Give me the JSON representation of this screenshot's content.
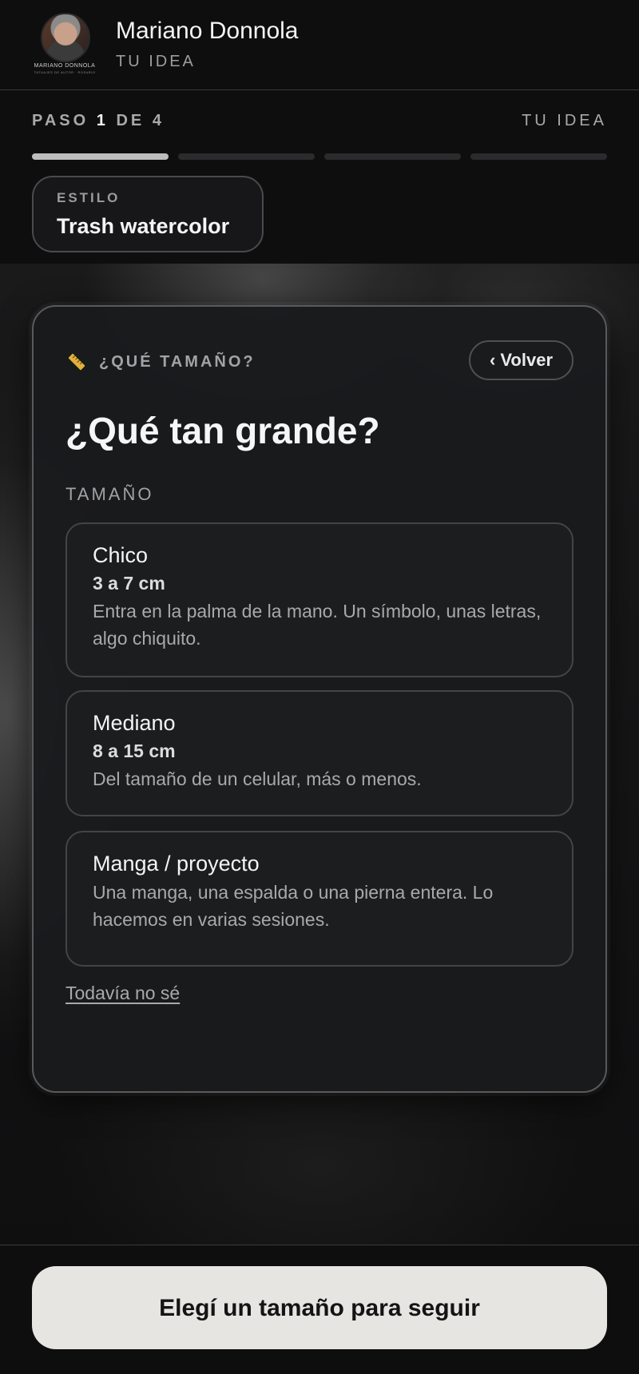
{
  "header": {
    "brand_name": "Mariano Donnola",
    "brand_sub": "TU IDEA",
    "logo_caption": "MARIANO DONNOLA",
    "logo_subcaption": "TATUAJES DE AUTOR · ROSARIO"
  },
  "step": {
    "prefix": "PASO",
    "current": "1",
    "middle": "DE",
    "total": "4",
    "section": "TU IDEA",
    "segments": [
      {
        "active": true
      },
      {
        "active": false
      },
      {
        "active": false
      },
      {
        "active": false
      }
    ]
  },
  "style_chip": {
    "label": "ESTILO",
    "value": "Trash watercolor"
  },
  "card": {
    "icon": "ruler-icon",
    "kicker": "¿QUÉ TAMAÑO?",
    "back_label": "‹ Volver",
    "title": "¿Qué tan grande?",
    "field_label": "TAMAÑO",
    "options": [
      {
        "name": "Chico",
        "size": "3 a 7 cm",
        "description": "Entra en la palma de la mano. Un símbolo, unas letras, algo chiquito."
      },
      {
        "name": "Mediano",
        "size": "8 a 15 cm",
        "description": "Del tamaño de un celular, más o menos."
      },
      {
        "name": "Manga / proyecto",
        "size": "",
        "description": "Una manga, una espalda o una pierna entera. Lo hacemos en varias sesiones."
      }
    ],
    "unsure_label": "Todavía no sé"
  },
  "footer": {
    "cta_label": "Elegí un tamaño para seguir"
  },
  "colors": {
    "background": "#0e0e0f",
    "card": "#1a1b1d",
    "cta_background": "#e6e5e2",
    "progress_active": "#bdbdbd",
    "progress_inactive": "#2b2b2d",
    "ruler_accent": "#e0b23a"
  }
}
